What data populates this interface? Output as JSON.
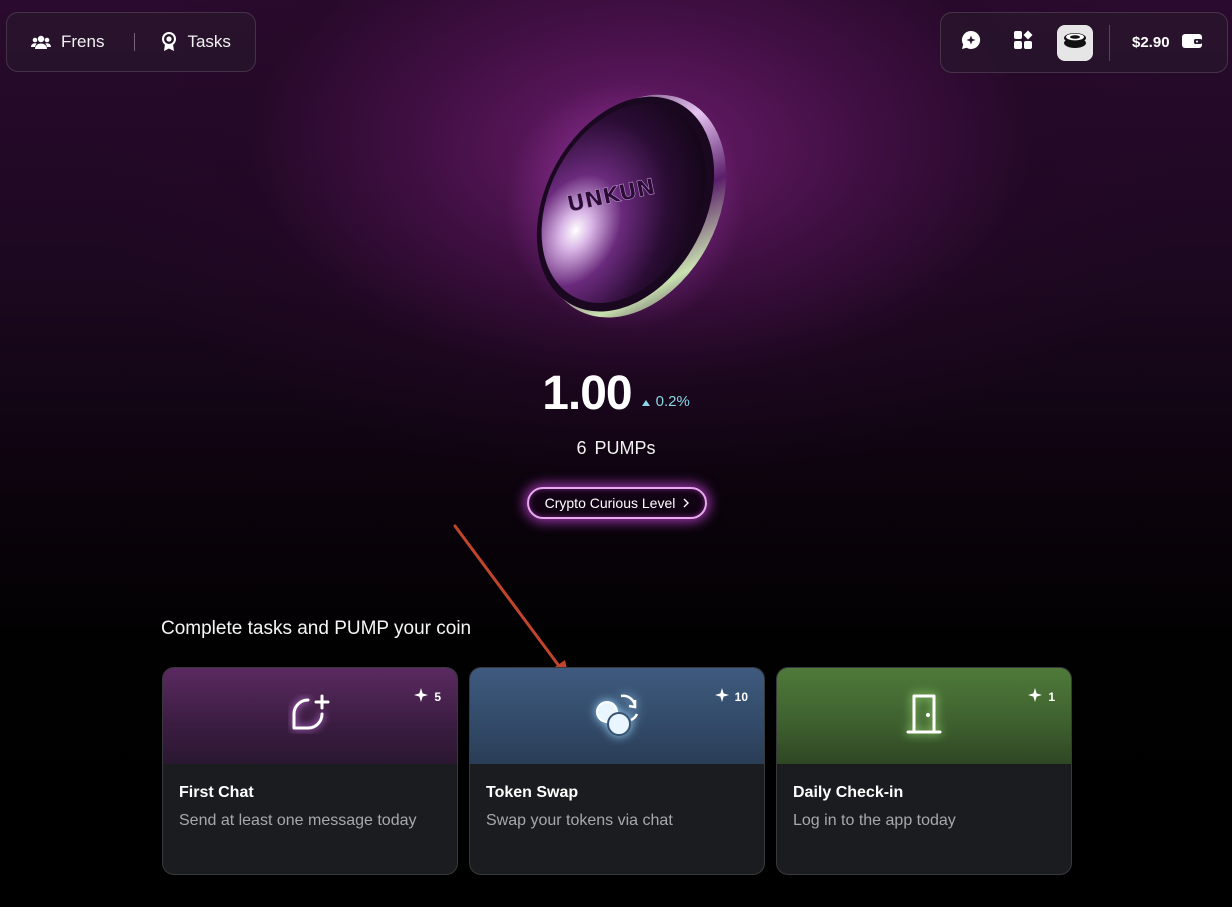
{
  "nav": {
    "frens_label": "Frens",
    "tasks_label": "Tasks"
  },
  "topbar": {
    "balance": "$2.90"
  },
  "coin": {
    "logo_text": "UNKUN"
  },
  "stats": {
    "price": "1.00",
    "change": "0.2%",
    "pumps": "6 PUMPs",
    "level_label": "Crypto Curious Level"
  },
  "tasks": {
    "section_title": "Complete tasks and PUMP your coin",
    "items": [
      {
        "title": "First Chat",
        "description": "Send at least one message today",
        "reward": "5"
      },
      {
        "title": "Token Swap",
        "description": "Swap your tokens via chat",
        "reward": "10"
      },
      {
        "title": "Daily Check-in",
        "description": "Log in to the app today",
        "reward": "1"
      }
    ]
  },
  "colors": {
    "accent_purple": "#c94fe0",
    "change_teal": "#8ad7e6",
    "annotation_arrow": "#c0452c",
    "card_bg": "#1b1c1f"
  }
}
